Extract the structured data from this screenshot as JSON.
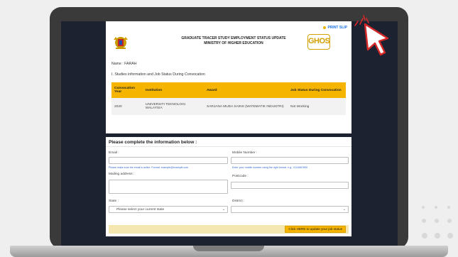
{
  "header": {
    "print_slip": "PRINT SLIP",
    "title_line1": "GRADUATE TRACER STUDY EMPLOYMENT STATUS UPDATE",
    "title_line2": "MINISTRY OF HIGHER EDUCATION",
    "logo_text": "GHOS"
  },
  "student": {
    "name_line": "Name : FARAH"
  },
  "studies": {
    "section_title": "I. Studies information and Job Status During Convocation",
    "columns": [
      "Convocation Year",
      "Institution",
      "Award",
      "Job Status During Convocation"
    ],
    "rows": [
      [
        "2020",
        "UNIVERSITI TEKNOLOGI MALAYSIA",
        "SARJANA MUDA SAINS (MATEMATIK INDUSTRI)",
        "Not Working"
      ]
    ]
  },
  "form": {
    "title": "Please complete the information below :",
    "email_label": "Email :",
    "email_value": "",
    "email_hint": "Please make sure the email is active. Format: example@example.com",
    "mobile_label": "Mobile Number :",
    "mobile_value": "",
    "mobile_hint": "Enter your mobile number using the right format. e.g.: 0124567890",
    "address_label": "Mailing address :",
    "address_value": "",
    "postcode_label": "Postcode :",
    "postcode_value": "",
    "state_label": "State :",
    "state_value": "Please select your current state",
    "district_label": "District :",
    "district_value": "",
    "update_button": "Click HERE to update your job status"
  },
  "colors": {
    "accent": "#f5b400",
    "link": "#1a73e8",
    "screen_bg": "#1d2231"
  },
  "icons": [
    "print-icon",
    "crest-icon",
    "ghos-logo",
    "chevron-down-icon",
    "cursor-icon"
  ]
}
